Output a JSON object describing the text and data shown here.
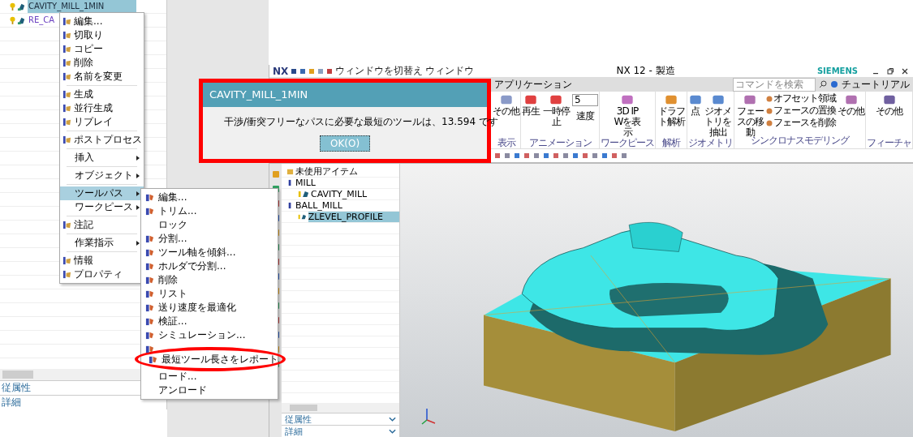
{
  "left_tree": {
    "rows": [
      {
        "label": "CAVITY_MILL_1MIN",
        "selected": true
      },
      {
        "label": "RE_CA",
        "selected": false
      }
    ],
    "panels": [
      "従属性",
      "詳細"
    ]
  },
  "context_menu": {
    "items": [
      {
        "kind": "command",
        "label": "編集...",
        "selected": false
      },
      {
        "kind": "command",
        "label": "切取り",
        "selected": false
      },
      {
        "kind": "command",
        "label": "コピー",
        "selected": false
      },
      {
        "kind": "command",
        "label": "削除",
        "selected": false
      },
      {
        "kind": "command",
        "label": "名前を変更",
        "selected": false
      },
      {
        "kind": "separator"
      },
      {
        "kind": "command",
        "label": "生成",
        "selected": false
      },
      {
        "kind": "command",
        "label": "並行生成",
        "selected": false
      },
      {
        "kind": "command",
        "label": "リプレイ",
        "selected": false
      },
      {
        "kind": "separator"
      },
      {
        "kind": "command",
        "label": "ポストプロセス",
        "selected": false
      },
      {
        "kind": "separator"
      },
      {
        "kind": "submenu",
        "label": "挿入",
        "selected": false
      },
      {
        "kind": "separator"
      },
      {
        "kind": "submenu",
        "label": "オブジェクト",
        "selected": false
      },
      {
        "kind": "separator"
      },
      {
        "kind": "submenu",
        "label": "ツールパス",
        "selected": true
      },
      {
        "kind": "submenu",
        "label": "ワークピース",
        "selected": false
      },
      {
        "kind": "separator"
      },
      {
        "kind": "command",
        "label": "注記",
        "selected": false
      },
      {
        "kind": "separator"
      },
      {
        "kind": "submenu",
        "label": "作業指示",
        "selected": false
      },
      {
        "kind": "separator"
      },
      {
        "kind": "command",
        "label": "情報",
        "selected": false
      },
      {
        "kind": "command",
        "label": "プロパティ",
        "selected": false
      }
    ]
  },
  "submenu": {
    "items": [
      {
        "label": "編集...",
        "icon": true,
        "circled": false
      },
      {
        "label": "トリム...",
        "icon": true,
        "circled": false
      },
      {
        "label": "ロック",
        "icon": false,
        "circled": false
      },
      {
        "label": "分割...",
        "icon": true,
        "circled": false
      },
      {
        "label": "ツール軸を傾斜...",
        "icon": true,
        "circled": false
      },
      {
        "label": "ホルダで分割...",
        "icon": true,
        "circled": false
      },
      {
        "label": "削除",
        "icon": true,
        "circled": false
      },
      {
        "label": "リスト",
        "icon": true,
        "circled": false
      },
      {
        "label": "送り速度を最適化",
        "icon": true,
        "circled": false
      },
      {
        "label": "検証...",
        "icon": true,
        "circled": false
      },
      {
        "label": "シミュレーション...",
        "icon": true,
        "circled": false
      },
      {
        "icon": true,
        "circled": false
      },
      {
        "label": "最短ツール長さをレポート",
        "icon": true,
        "circled": true
      },
      {
        "label": "ロード...",
        "icon": false,
        "circled": false
      },
      {
        "label": "アンロード",
        "icon": false,
        "circled": false
      }
    ]
  },
  "dialog": {
    "title": "CAVITY_MILL_1MIN",
    "message": "干渉/衝突フリーなパスに必要な最短のツールは、13.594 です",
    "button": "OK(O)"
  },
  "nx_window": {
    "app": "NX",
    "quick_access": [
      "ウィンドウを切替え",
      "ウィンドウ"
    ],
    "title": "NX 12 - 製造",
    "brand": "SIEMENS",
    "tab": "アプリケーション",
    "search": {
      "placeholder": "コマンドを検索"
    },
    "tutorial": "チュートリアル",
    "ribbon_groups": [
      {
        "label": "表示",
        "buttons": [
          {
            "kind": "large",
            "label": "その他"
          }
        ]
      },
      {
        "label": "アニメーション",
        "buttons": [
          {
            "kind": "large",
            "label": "再生"
          },
          {
            "kind": "large",
            "label": "一時停止"
          },
          {
            "kind": "field",
            "value": "5",
            "label": "速度"
          }
        ]
      },
      {
        "label": "ワークピース",
        "buttons": [
          {
            "kind": "large",
            "label": "3D IPWを表示"
          }
        ]
      },
      {
        "label": "解析",
        "buttons": [
          {
            "kind": "large",
            "label": "ドラフト解析"
          }
        ]
      },
      {
        "label": "ジオメトリ",
        "buttons": [
          {
            "kind": "large",
            "label": "点"
          },
          {
            "kind": "large",
            "label": "ジオメトリを抽出"
          }
        ]
      },
      {
        "label": "シンクロナスモデリング",
        "buttons": [
          {
            "kind": "large",
            "label": "フェースの移動"
          },
          {
            "kind": "small",
            "label": "オフセット領域"
          },
          {
            "kind": "small",
            "label": "フェースの置換"
          },
          {
            "kind": "small",
            "label": "フェースを削除"
          },
          {
            "kind": "large",
            "label": "その他"
          }
        ]
      },
      {
        "label": "フィーチャ",
        "buttons": [
          {
            "kind": "large",
            "label": "その他"
          }
        ]
      }
    ],
    "navigator": {
      "tree": [
        {
          "label": "未使用アイテム",
          "kind": "folder"
        },
        {
          "label": "MILL",
          "kind": "tool",
          "children": [
            {
              "label": "CAVITY_MILL",
              "kind": "operation",
              "selected": false
            }
          ]
        },
        {
          "label": "BALL_MILL",
          "kind": "tool",
          "children": [
            {
              "label": "ZLEVEL_PROFILE",
              "kind": "operation",
              "selected": true
            }
          ]
        }
      ],
      "panels": [
        "従属性",
        "詳細"
      ]
    }
  }
}
